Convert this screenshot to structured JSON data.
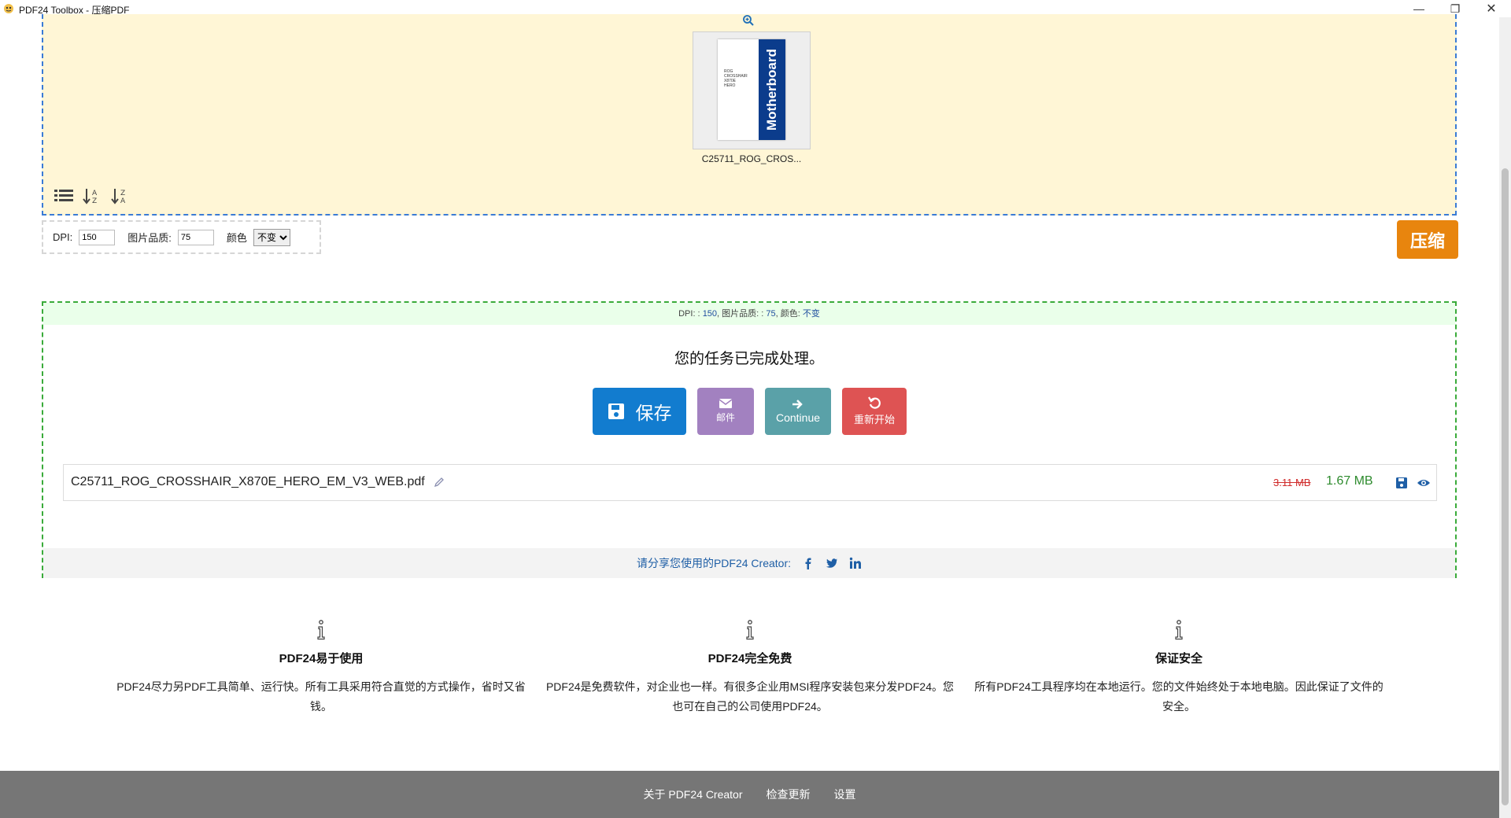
{
  "window": {
    "title": "PDF24 Toolbox - 压缩PDF"
  },
  "drop_area": {
    "file_thumb_name": "C25711_ROG_CROS...",
    "thumb_brand_text": "Motherboard",
    "thumb_small_text": "ROG\nCROSSHAIR\nX870E\nHERO"
  },
  "options": {
    "dpi_label": "DPI:",
    "dpi_value": "150",
    "quality_label": "图片品质:",
    "quality_value": "75",
    "color_label": "颜色",
    "color_selected": "不变"
  },
  "compress_label": "压缩",
  "result": {
    "summary": {
      "dpi_label": "DPI: :",
      "dpi": "150",
      "quality_label": ", 图片品质: :",
      "quality": "75",
      "color_label": ", 颜色:",
      "color": "不变"
    },
    "done_message": "您的任务已完成处理。",
    "save_label": "保存",
    "mail_label": "邮件",
    "continue_label": "Continue",
    "restart_label": "重新开始",
    "file": {
      "name": "C25711_ROG_CROSSHAIR_X870E_HERO_EM_V3_WEB.pdf",
      "old_size": "3.11 MB",
      "new_size": "1.67 MB"
    },
    "share_text": "请分享您使用的PDF24 Creator:"
  },
  "features": [
    {
      "title": "PDF24易于使用",
      "text": "PDF24尽力另PDF工具简单、运行快。所有工具采用符合直觉的方式操作，省时又省钱。"
    },
    {
      "title": "PDF24完全免费",
      "text": "PDF24是免费软件，对企业也一样。有很多企业用MSI程序安装包来分发PDF24。您也可在自己的公司使用PDF24。"
    },
    {
      "title": "保证安全",
      "text": "所有PDF24工具程序均在本地运行。您的文件始终处于本地电脑。因此保证了文件的安全。"
    }
  ],
  "footer": {
    "about": "关于 PDF24 Creator",
    "check_update": "检查更新",
    "settings": "设置"
  },
  "colors": {
    "drop_bg": "#fff6d6",
    "drop_border": "#3a7bd5",
    "compress": "#e8850e",
    "save": "#127ccf",
    "mail": "#a281c0",
    "continue": "#5aa1a8",
    "restart": "#de5353",
    "result_border": "#3aab3a",
    "footer": "#767676"
  }
}
